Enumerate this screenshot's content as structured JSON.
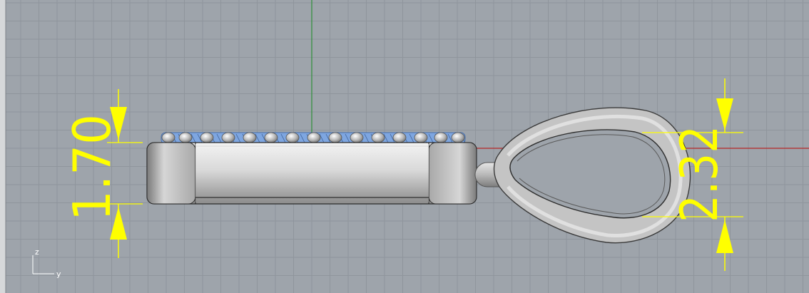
{
  "viewport": {
    "background": "#9ea4ab",
    "grid_color": "#8f959c",
    "grid_major_color": "#878d94",
    "x_axis_color": "#b42828",
    "y_axis_color": "#2f8f3a",
    "dimension_color": "#ffff00",
    "gem_color": "#7ea6e0"
  },
  "dimensions": {
    "left_value": "1.70",
    "right_value": "2.32"
  },
  "axis_triad": {
    "z_label": "z",
    "y_label": "y"
  }
}
